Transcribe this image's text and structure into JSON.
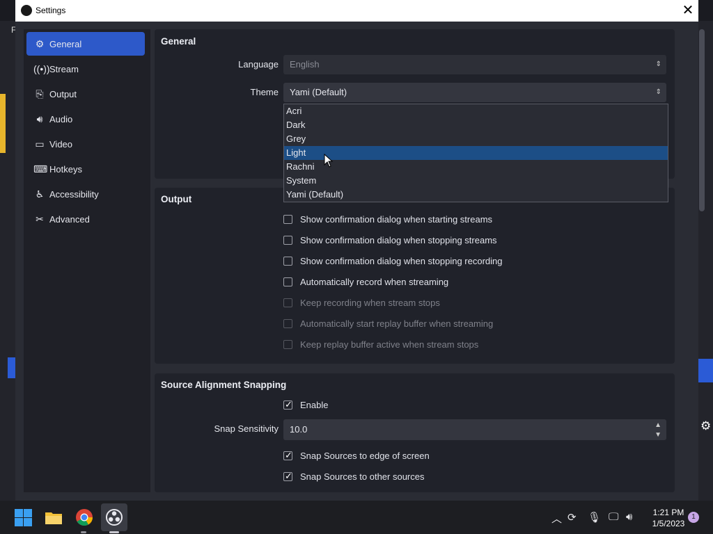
{
  "window": {
    "title": "Settings"
  },
  "background": {
    "letter": "F"
  },
  "sidebar": {
    "items": [
      {
        "label": "General",
        "icon": "gear-icon"
      },
      {
        "label": "Stream",
        "icon": "antenna-icon"
      },
      {
        "label": "Output",
        "icon": "output-icon"
      },
      {
        "label": "Audio",
        "icon": "speaker-icon"
      },
      {
        "label": "Video",
        "icon": "monitor-icon"
      },
      {
        "label": "Hotkeys",
        "icon": "keyboard-icon"
      },
      {
        "label": "Accessibility",
        "icon": "accessibility-icon"
      },
      {
        "label": "Advanced",
        "icon": "tools-icon"
      }
    ]
  },
  "general": {
    "title": "General",
    "language_label": "Language",
    "language_value": "English",
    "theme_label": "Theme",
    "theme_value": "Yami (Default)",
    "theme_options": [
      "Acri",
      "Dark",
      "Grey",
      "Light",
      "Rachni",
      "System",
      "Yami (Default)"
    ],
    "highlighted_option": "Light"
  },
  "output": {
    "title": "Output",
    "checkboxes": [
      {
        "label": "Show confirmation dialog when starting streams",
        "checked": false,
        "disabled": false
      },
      {
        "label": "Show confirmation dialog when stopping streams",
        "checked": false,
        "disabled": false
      },
      {
        "label": "Show confirmation dialog when stopping recording",
        "checked": false,
        "disabled": false
      },
      {
        "label": "Automatically record when streaming",
        "checked": false,
        "disabled": false
      },
      {
        "label": "Keep recording when stream stops",
        "checked": false,
        "disabled": true
      },
      {
        "label": "Automatically start replay buffer when streaming",
        "checked": false,
        "disabled": true
      },
      {
        "label": "Keep replay buffer active when stream stops",
        "checked": false,
        "disabled": true
      }
    ]
  },
  "snapping": {
    "title": "Source Alignment Snapping",
    "enable_label": "Enable",
    "sensitivity_label": "Snap Sensitivity",
    "sensitivity_value": "10.0",
    "edge_label": "Snap Sources to edge of screen",
    "other_label": "Snap Sources to other sources"
  },
  "taskbar": {
    "time": "1:21 PM",
    "date": "1/5/2023",
    "notification_count": "1"
  },
  "colors": {
    "accent": "#2d59c9",
    "highlight": "#1c4e86",
    "panel": "#20222a"
  }
}
